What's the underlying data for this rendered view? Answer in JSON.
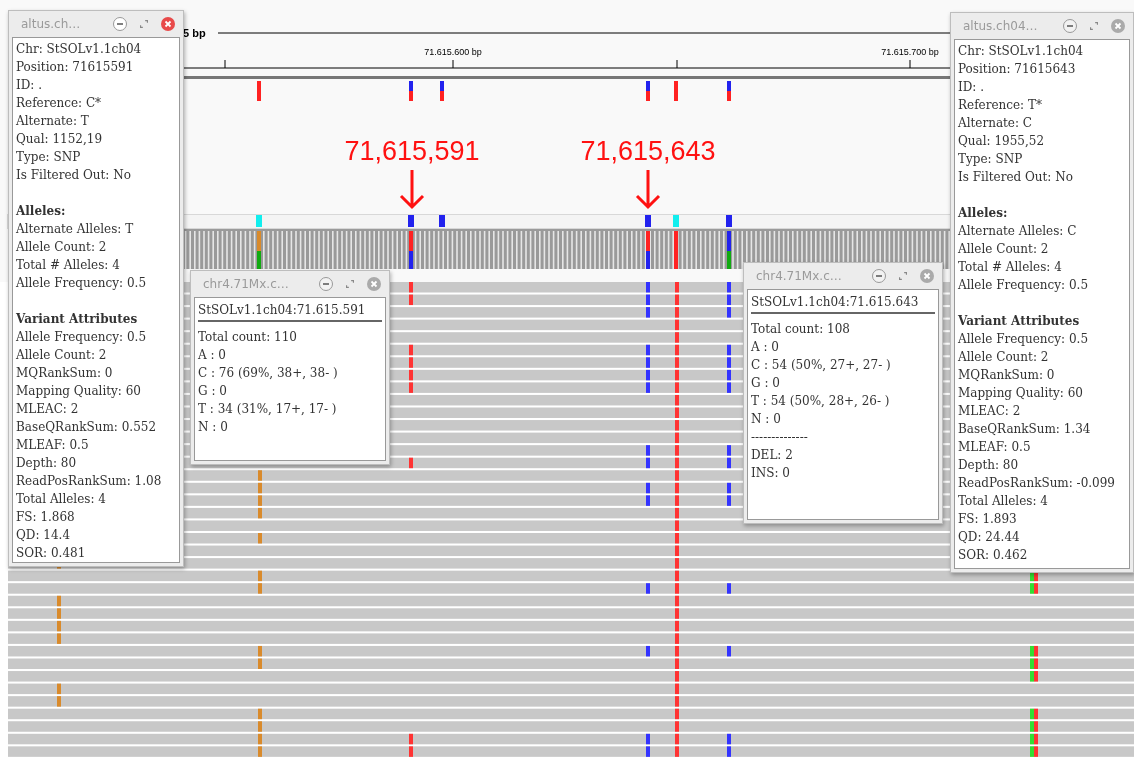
{
  "ruler": {
    "span_label": "5 bp",
    "ticks": [
      "71.615.600 bp",
      "71.615.700 bp"
    ]
  },
  "annotations": [
    {
      "label": "71,615,591"
    },
    {
      "label": "71,615,643"
    }
  ],
  "popups": [
    {
      "kind": "variant",
      "title": "altus.ch…",
      "active": true,
      "sections": [
        {
          "lines": [
            "Chr: StSOLv1.1ch04",
            "Position: 71615591",
            "ID: .",
            "Reference: C*",
            "Alternate: T",
            "Qual: 1152,19",
            "Type: SNP",
            "Is Filtered Out: No"
          ]
        },
        {
          "heading": "Alleles:",
          "lines": [
            "Alternate Alleles: T",
            "Allele Count: 2",
            "Total # Alleles: 4",
            "Allele Frequency: 0.5"
          ]
        },
        {
          "heading": "Variant Attributes",
          "lines": [
            "Allele Frequency: 0.5",
            "Allele Count: 2",
            "MQRankSum: 0",
            "Mapping Quality: 60",
            "MLEAC: 2",
            "BaseQRankSum: 0.552",
            "MLEAF: 0.5",
            "Depth: 80",
            "ReadPosRankSum: 1.08",
            "Total Alleles: 4",
            "FS: 1.868",
            "QD: 14.4",
            "SOR: 0.481"
          ]
        }
      ]
    },
    {
      "kind": "count",
      "title": "chr4.71Mx.c…",
      "active": false,
      "header": "StSOLv1.1ch04:71.615.591",
      "sections": [
        {
          "lines": [
            "Total count: 110",
            "A : 0",
            "C : 76 (69%, 38+, 38- )",
            "G : 0",
            "T : 34 (31%, 17+, 17- )",
            "N : 0"
          ]
        }
      ]
    },
    {
      "kind": "count",
      "title": "chr4.71Mx.c…",
      "active": false,
      "header": "StSOLv1.1ch04:71.615.643",
      "sections": [
        {
          "lines": [
            "Total count: 108",
            "A : 0",
            "C : 54 (50%, 27+, 27- )",
            "G : 0",
            "T : 54 (50%, 28+, 26- )",
            "N : 0",
            "--------------",
            "DEL: 2",
            "INS: 0"
          ]
        }
      ]
    },
    {
      "kind": "variant",
      "title": "altus.ch04…",
      "active": false,
      "sections": [
        {
          "lines": [
            "Chr: StSOLv1.1ch04",
            "Position: 71615643",
            "ID: .",
            "Reference: T*",
            "Alternate: C",
            "Qual: 1955,52",
            "Type: SNP",
            "Is Filtered Out: No"
          ]
        },
        {
          "heading": "Alleles:",
          "lines": [
            "Alternate Alleles: C",
            "Allele Count: 2",
            "Total # Alleles: 4",
            "Allele Frequency: 0.5"
          ]
        },
        {
          "heading": "Variant Attributes",
          "lines": [
            "Allele Frequency: 0.5",
            "Allele Count: 2",
            "MQRankSum: 0",
            "Mapping Quality: 60",
            "MLEAC: 2",
            "BaseQRankSum: 1.34",
            "MLEAF: 0.5",
            "Depth: 80",
            "ReadPosRankSum: -0.099",
            "Total Alleles: 4",
            "FS: 1.893",
            "QD: 24.44",
            "SOR: 0.462"
          ]
        }
      ]
    }
  ]
}
